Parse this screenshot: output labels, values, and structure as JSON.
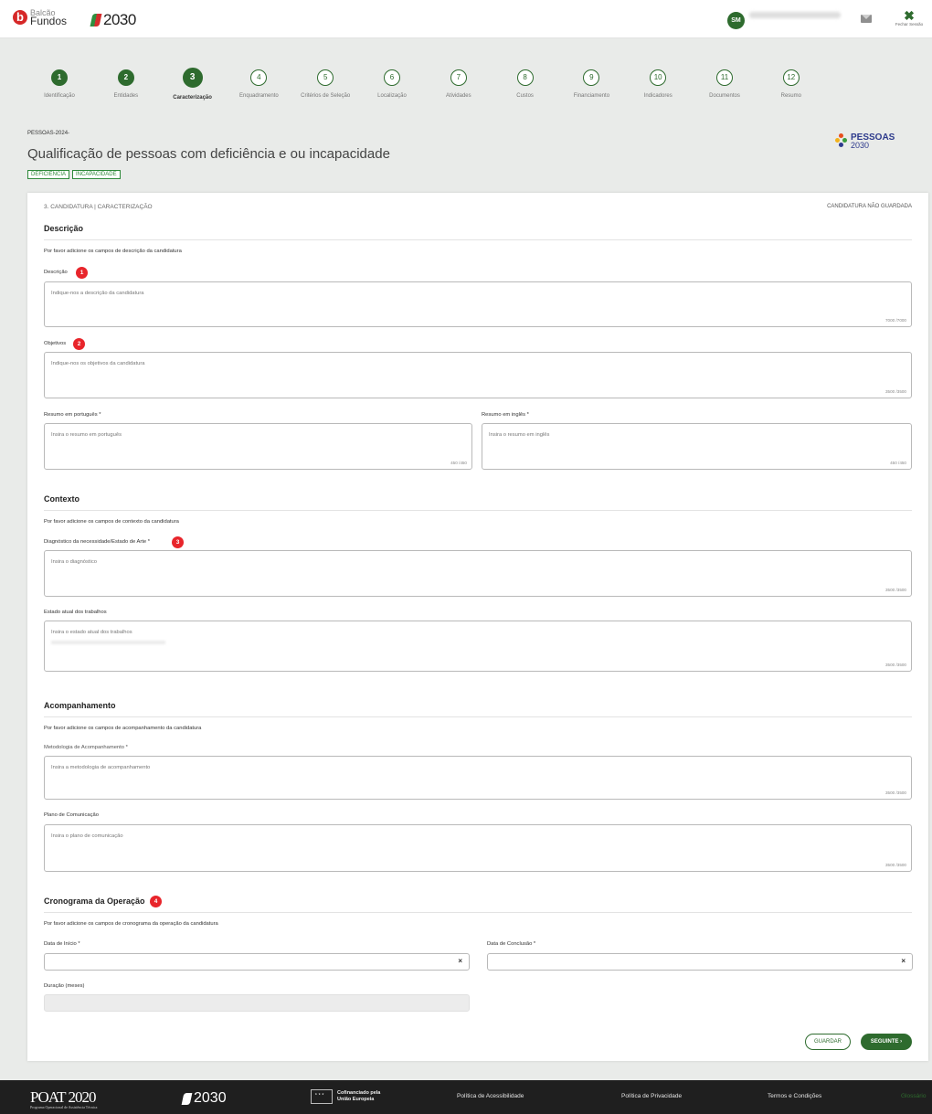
{
  "header": {
    "brand_line1": "Balcão",
    "brand_line2": "Fundos",
    "program_small": "PORTUGAL",
    "program_year": "2030",
    "avatar_initials": "SM",
    "logout_label": "Fechar Sessão"
  },
  "stepper": [
    {
      "n": "1",
      "label": "Identificação",
      "state": "done"
    },
    {
      "n": "2",
      "label": "Entidades",
      "state": "done"
    },
    {
      "n": "3",
      "label": "Caracterização",
      "state": "active"
    },
    {
      "n": "4",
      "label": "Enquadramento",
      "state": "todo"
    },
    {
      "n": "5",
      "label": "Critérios de Seleção",
      "state": "todo"
    },
    {
      "n": "6",
      "label": "Localização",
      "state": "todo"
    },
    {
      "n": "7",
      "label": "Atividades",
      "state": "todo"
    },
    {
      "n": "8",
      "label": "Custos",
      "state": "todo"
    },
    {
      "n": "9",
      "label": "Financiamento",
      "state": "todo"
    },
    {
      "n": "10",
      "label": "Indicadores",
      "state": "todo"
    },
    {
      "n": "11",
      "label": "Documentos",
      "state": "todo"
    },
    {
      "n": "12",
      "label": "Resumo",
      "state": "todo"
    }
  ],
  "notice": {
    "code": "PESSOAS-2024-",
    "title": "Qualificação de pessoas com deficiência e ou incapacidade",
    "tags": [
      "DEFICIÊNCIA",
      "INCAPACIDADE"
    ],
    "program_logo_line1": "PESSOAS",
    "program_logo_line2": "2030"
  },
  "card": {
    "breadcrumb": "3. CANDIDATURA | CARACTERIZAÇÃO",
    "status": "CANDIDATURA NÃO GUARDADA"
  },
  "descricao": {
    "title": "Descrição",
    "hint": "Por favor adicione os campos de descrição da candidatura",
    "descricao_label": "Descrição",
    "descricao_placeholder": "Indique-nos a descrição da candidatura",
    "descricao_count": "7000 /7000",
    "objetivos_label": "Objetivos",
    "objetivos_placeholder": "Indique-nos os objetivos da candidatura",
    "objetivos_count": "3500 /3500",
    "resumo_pt_label": "Resumo em português *",
    "resumo_pt_placeholder": "Insira o resumo em português",
    "resumo_pt_count": "450 /450",
    "resumo_en_label": "Resumo em inglês *",
    "resumo_en_placeholder": "Insira o resumo em inglês",
    "resumo_en_count": "450 /450"
  },
  "contexto": {
    "title": "Contexto",
    "hint": "Por favor adicione os campos de contexto da candidatura",
    "diag_label": "Diagnóstico da necessidade/Estado de Arte *",
    "diag_placeholder": "Insira o diagnóstico",
    "diag_count": "3500 /3500",
    "estado_label": "Estado atual dos trabalhos",
    "estado_placeholder": "Insira o estado atual dos trabalhos",
    "estado_count": "3500 /3500"
  },
  "acompanhamento": {
    "title": "Acompanhamento",
    "hint": "Por favor adicione os campos de acompanhamento da candidatura",
    "metod_label": "Metodologia de Acompanhamento *",
    "metod_placeholder": "Insira a metodologia de acompanhamento",
    "metod_count": "3500 /3500",
    "plano_label": "Plano de Comunicação",
    "plano_placeholder": "Insira o plano de comunicação",
    "plano_count": "3500 /3500"
  },
  "cronograma": {
    "title": "Cronograma da Operação",
    "hint": "Por favor adicione os campos de cronograma da operação da candidatura",
    "inicio_label": "Data de Início *",
    "conclusao_label": "Data de Conclusão *",
    "duracao_label": "Duração (meses)",
    "clear_symbol": "×"
  },
  "annotations": [
    "1",
    "2",
    "3",
    "4"
  ],
  "actions": {
    "guardar": "GUARDAR",
    "seguinte": "SEGUINTE ›"
  },
  "footer": {
    "poat": "POAT 2020",
    "poat_sub": "Programa Operacional de Assistência Técnica",
    "portugal": "PORTUGAL",
    "year": "2030",
    "eu_line1": "Cofinanciado pela",
    "eu_line2": "União Europeia",
    "acessibilidade": "Política de Acessibilidade",
    "privacidade": "Política de Privacidade",
    "termos": "Termos e Condições",
    "glossario": "Glossário"
  },
  "colors": {
    "primary_green": "#2e6b2e",
    "annotation_red": "#e8252b",
    "tag_green": "#2e8a3a"
  }
}
